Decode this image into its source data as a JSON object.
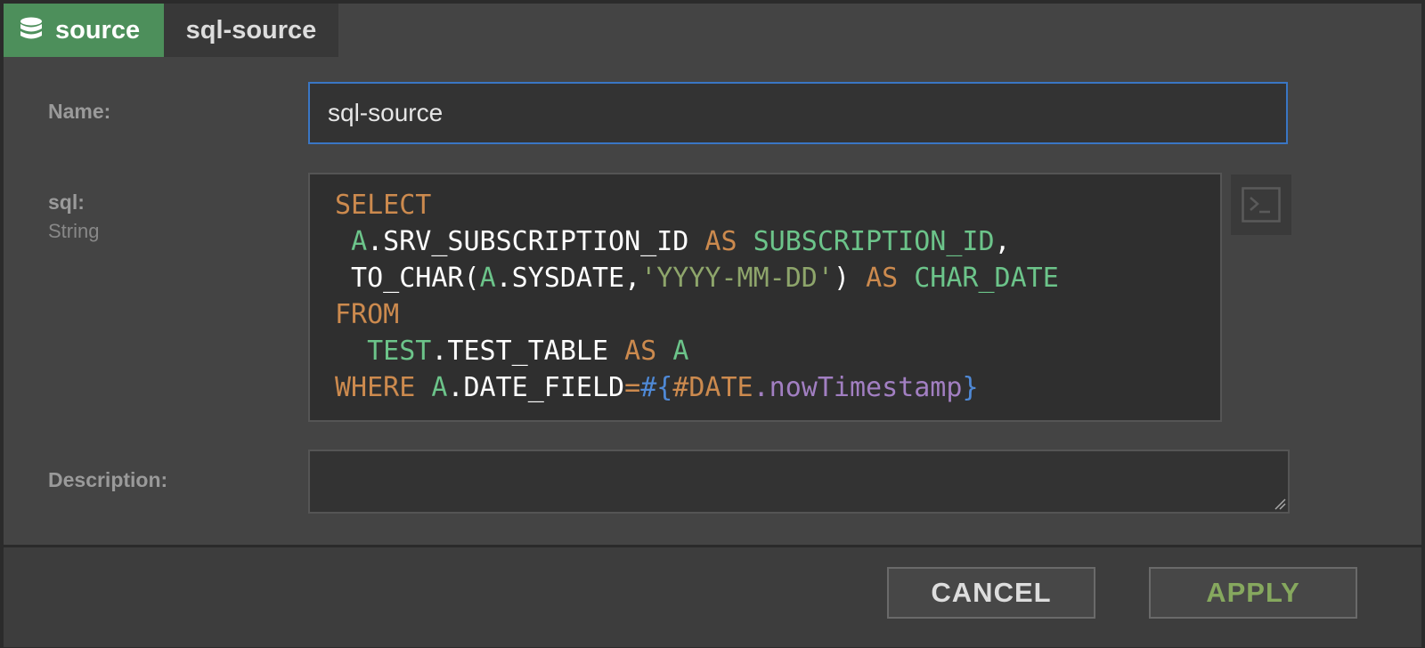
{
  "header": {
    "type_label": "source",
    "type_icon": "database-icon",
    "node_name": "sql-source"
  },
  "form": {
    "name": {
      "label": "Name:",
      "value": "sql-source"
    },
    "sql": {
      "label": "sql:",
      "type": "String",
      "lines": [
        [
          {
            "t": "kw",
            "v": "SELECT"
          }
        ],
        [
          {
            "t": "plain",
            "v": " "
          },
          {
            "t": "id",
            "v": "A"
          },
          {
            "t": "plain",
            "v": ".SRV_SUBSCRIPTION_ID "
          },
          {
            "t": "kw",
            "v": "AS"
          },
          {
            "t": "plain",
            "v": " "
          },
          {
            "t": "id",
            "v": "SUBSCRIPTION_ID"
          },
          {
            "t": "plain",
            "v": ","
          }
        ],
        [
          {
            "t": "plain",
            "v": " TO_CHAR("
          },
          {
            "t": "id",
            "v": "A"
          },
          {
            "t": "plain",
            "v": ".SYSDATE,"
          },
          {
            "t": "str",
            "v": "'YYYY-MM-DD'"
          },
          {
            "t": "plain",
            "v": ") "
          },
          {
            "t": "kw",
            "v": "AS"
          },
          {
            "t": "plain",
            "v": " "
          },
          {
            "t": "id",
            "v": "CHAR_DATE"
          }
        ],
        [
          {
            "t": "kw",
            "v": "FROM"
          }
        ],
        [
          {
            "t": "plain",
            "v": "  "
          },
          {
            "t": "id",
            "v": "TEST"
          },
          {
            "t": "plain",
            "v": ".TEST_TABLE "
          },
          {
            "t": "kw",
            "v": "AS"
          },
          {
            "t": "plain",
            "v": " "
          },
          {
            "t": "id",
            "v": "A"
          }
        ],
        [
          {
            "t": "kw",
            "v": "WHERE"
          },
          {
            "t": "plain",
            "v": " "
          },
          {
            "t": "id",
            "v": "A"
          },
          {
            "t": "plain",
            "v": ".DATE_FIELD"
          },
          {
            "t": "op",
            "v": "="
          },
          {
            "t": "br",
            "v": "#{"
          },
          {
            "t": "var",
            "v": "#DATE"
          },
          {
            "t": "fn",
            "v": ".nowTimestamp"
          },
          {
            "t": "br",
            "v": "}"
          }
        ]
      ],
      "expand_icon": "terminal-icon"
    },
    "description": {
      "label": "Description:",
      "value": ""
    }
  },
  "footer": {
    "cancel_label": "CANCEL",
    "apply_label": "APPLY"
  }
}
